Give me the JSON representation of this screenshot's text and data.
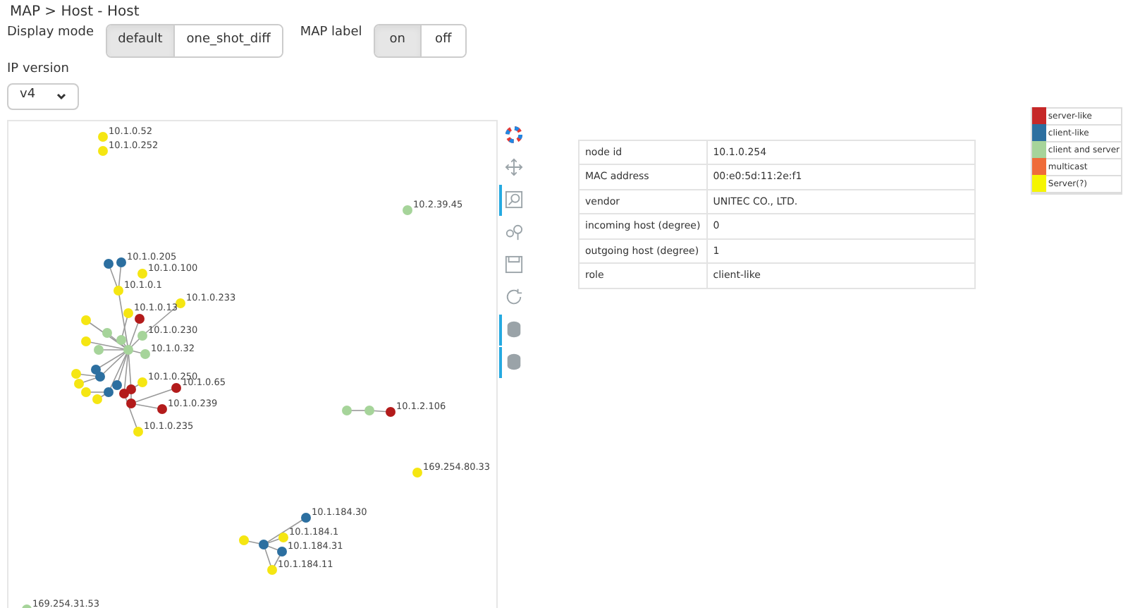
{
  "breadcrumb": "MAP > Host - Host",
  "display_mode": {
    "label": "Display mode",
    "options": [
      {
        "label": "default",
        "selected": true
      },
      {
        "label": "one_shot_diff",
        "selected": false
      }
    ]
  },
  "map_label": {
    "label": "MAP label",
    "options": [
      {
        "label": "on",
        "selected": true
      },
      {
        "label": "off",
        "selected": false
      }
    ]
  },
  "ip_version": {
    "label": "IP version",
    "value": "v4"
  },
  "graph": {
    "nodes": [
      {
        "label": "10.1.0.52",
        "color": "#f5e612"
      },
      {
        "label": "10.1.0.252",
        "color": "#f5e612"
      },
      {
        "label": "10.2.39.45",
        "color": "#a6d49a"
      },
      {
        "color": "#2c6fa0"
      },
      {
        "label": "10.1.0.205",
        "color": "#2c6fa0"
      },
      {
        "label": "10.1.0.1",
        "color": "#f5e612"
      },
      {
        "label": "10.1.0.100",
        "color": "#f5e612"
      },
      {
        "label": "10.1.0.233",
        "color": "#f5e612"
      },
      {
        "color": "#b31b1b"
      },
      {
        "label": "10.1.0.13",
        "color": "#f5e612"
      },
      {
        "color": "#a6d49a"
      },
      {
        "color": "#a6d49a"
      },
      {
        "label": "10.1.0.230",
        "color": "#a6d49a"
      },
      {
        "color": "#a6d49a"
      },
      {
        "label": "10.1.0.32",
        "color": "#a6d49a"
      },
      {
        "color": "#f5e612"
      },
      {
        "color": "#f5e612"
      },
      {
        "color": "#a6d49a"
      },
      {
        "color": "#2c6fa0"
      },
      {
        "color": "#2c6fa0"
      },
      {
        "color": "#f5e612"
      },
      {
        "color": "#f5e612"
      },
      {
        "color": "#f5e612"
      },
      {
        "color": "#f5e612"
      },
      {
        "color": "#2c6fa0"
      },
      {
        "color": "#2c6fa0"
      },
      {
        "color": "#b31b1b"
      },
      {
        "color": "#b31b1b"
      },
      {
        "color": "#b31b1b"
      },
      {
        "label": "10.1.0.250",
        "color": "#f5e612"
      },
      {
        "label": "10.1.0.65",
        "color": "#b31b1b"
      },
      {
        "label": "10.1.0.239",
        "color": "#b31b1b"
      },
      {
        "label": "10.1.0.235",
        "color": "#f5e612"
      },
      {
        "color": "#a6d49a"
      },
      {
        "color": "#a6d49a"
      },
      {
        "label": "10.1.2.106",
        "color": "#b31b1b"
      },
      {
        "label": "169.254.80.33",
        "color": "#f5e612"
      },
      {
        "label": "10.1.184.30",
        "color": "#2c6fa0"
      },
      {
        "color": "#2c6fa0"
      },
      {
        "color": "#f5e612"
      },
      {
        "label": "10.1.184.1",
        "color": "#f5e612"
      },
      {
        "label": "10.1.184.31",
        "color": "#2c6fa0"
      },
      {
        "label": "10.1.184.11",
        "color": "#f5e612"
      },
      {
        "label": "169.254.31.53",
        "color": "#a6d49a"
      }
    ]
  },
  "tools": [
    {
      "kind": "logo",
      "selected": false
    },
    {
      "kind": "pan",
      "selected": false
    },
    {
      "kind": "zoom",
      "selected": true
    },
    {
      "kind": "boxzoom",
      "selected": false
    },
    {
      "kind": "save",
      "selected": false
    },
    {
      "kind": "reset",
      "selected": false
    },
    {
      "kind": "hover",
      "selected": true
    },
    {
      "kind": "hover",
      "selected": true
    }
  ],
  "info_table": [
    {
      "key": "node id",
      "value": "10.1.0.254"
    },
    {
      "key": "MAC address",
      "value": "00:e0:5d:11:2e:f1"
    },
    {
      "key": "vendor",
      "value": "UNITEC CO., LTD."
    },
    {
      "key": "incoming host (degree)",
      "value": "0"
    },
    {
      "key": "outgoing host (degree)",
      "value": "1"
    },
    {
      "key": "role",
      "value": "client-like"
    }
  ],
  "legend": [
    {
      "label": "server-like",
      "color": "#c62828"
    },
    {
      "label": "client-like",
      "color": "#2c6fa0"
    },
    {
      "label": "client and server",
      "color": "#a6d49a"
    },
    {
      "label": "multicast",
      "color": "#ef6c3a"
    },
    {
      "label": "Server(?)",
      "color": "#f5f500"
    }
  ]
}
